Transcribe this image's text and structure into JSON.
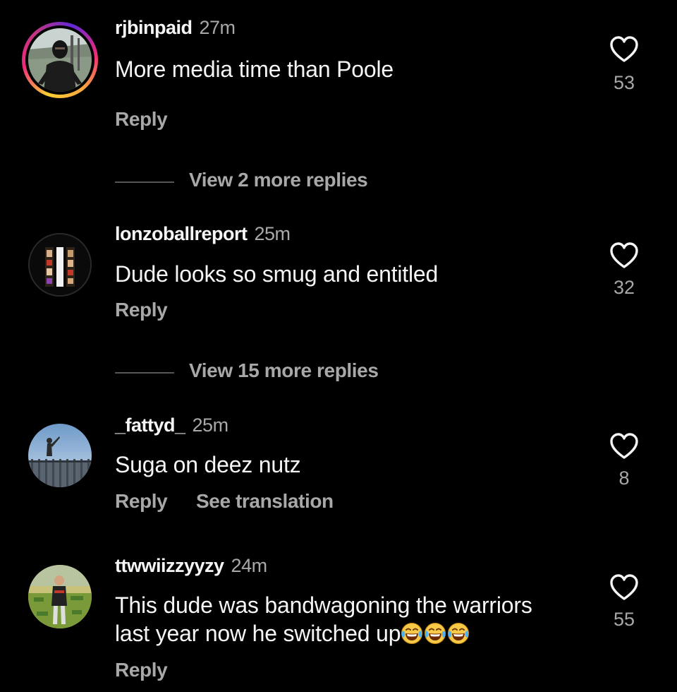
{
  "comments": [
    {
      "username": "rjbinpaid",
      "time": "27m",
      "text": "More media time than Poole",
      "reply_label": "Reply",
      "likes": "53",
      "avatar_icon": "masked-person-avatar",
      "has_story_ring": true
    },
    {
      "username": "lonzoballreport",
      "time": "25m",
      "text": "Dude looks so smug and entitled",
      "reply_label": "Reply",
      "likes": "32",
      "avatar_icon": "basketball-collage-avatar",
      "has_story_ring": false
    },
    {
      "username": "_fattyd_",
      "time": "25m",
      "text": "Suga on deez nutz",
      "reply_label": "Reply",
      "translate_label": "See translation",
      "likes": "8",
      "avatar_icon": "outdoor-person-avatar",
      "has_story_ring": false
    },
    {
      "username": "ttwwiizzyyzy",
      "time": "24m",
      "text_line1": "This dude was bandwagoning the warriors",
      "text_line2": "last year now he switched up",
      "emojis": [
        "face-with-tears-of-joy",
        "face-with-tears-of-joy",
        "face-with-tears-of-joy"
      ],
      "reply_label": "Reply",
      "likes": "55",
      "avatar_icon": "person-on-grass-avatar",
      "has_story_ring": false
    }
  ],
  "view_more": [
    {
      "label": "View 2 more replies"
    },
    {
      "label": "View 15 more replies"
    }
  ],
  "colors": {
    "background": "#000000",
    "primary_text": "#f5f5f5",
    "secondary_text": "#a8a8a8",
    "story_ring": [
      "#f9ce34",
      "#ee2a7b",
      "#6228d7"
    ]
  }
}
